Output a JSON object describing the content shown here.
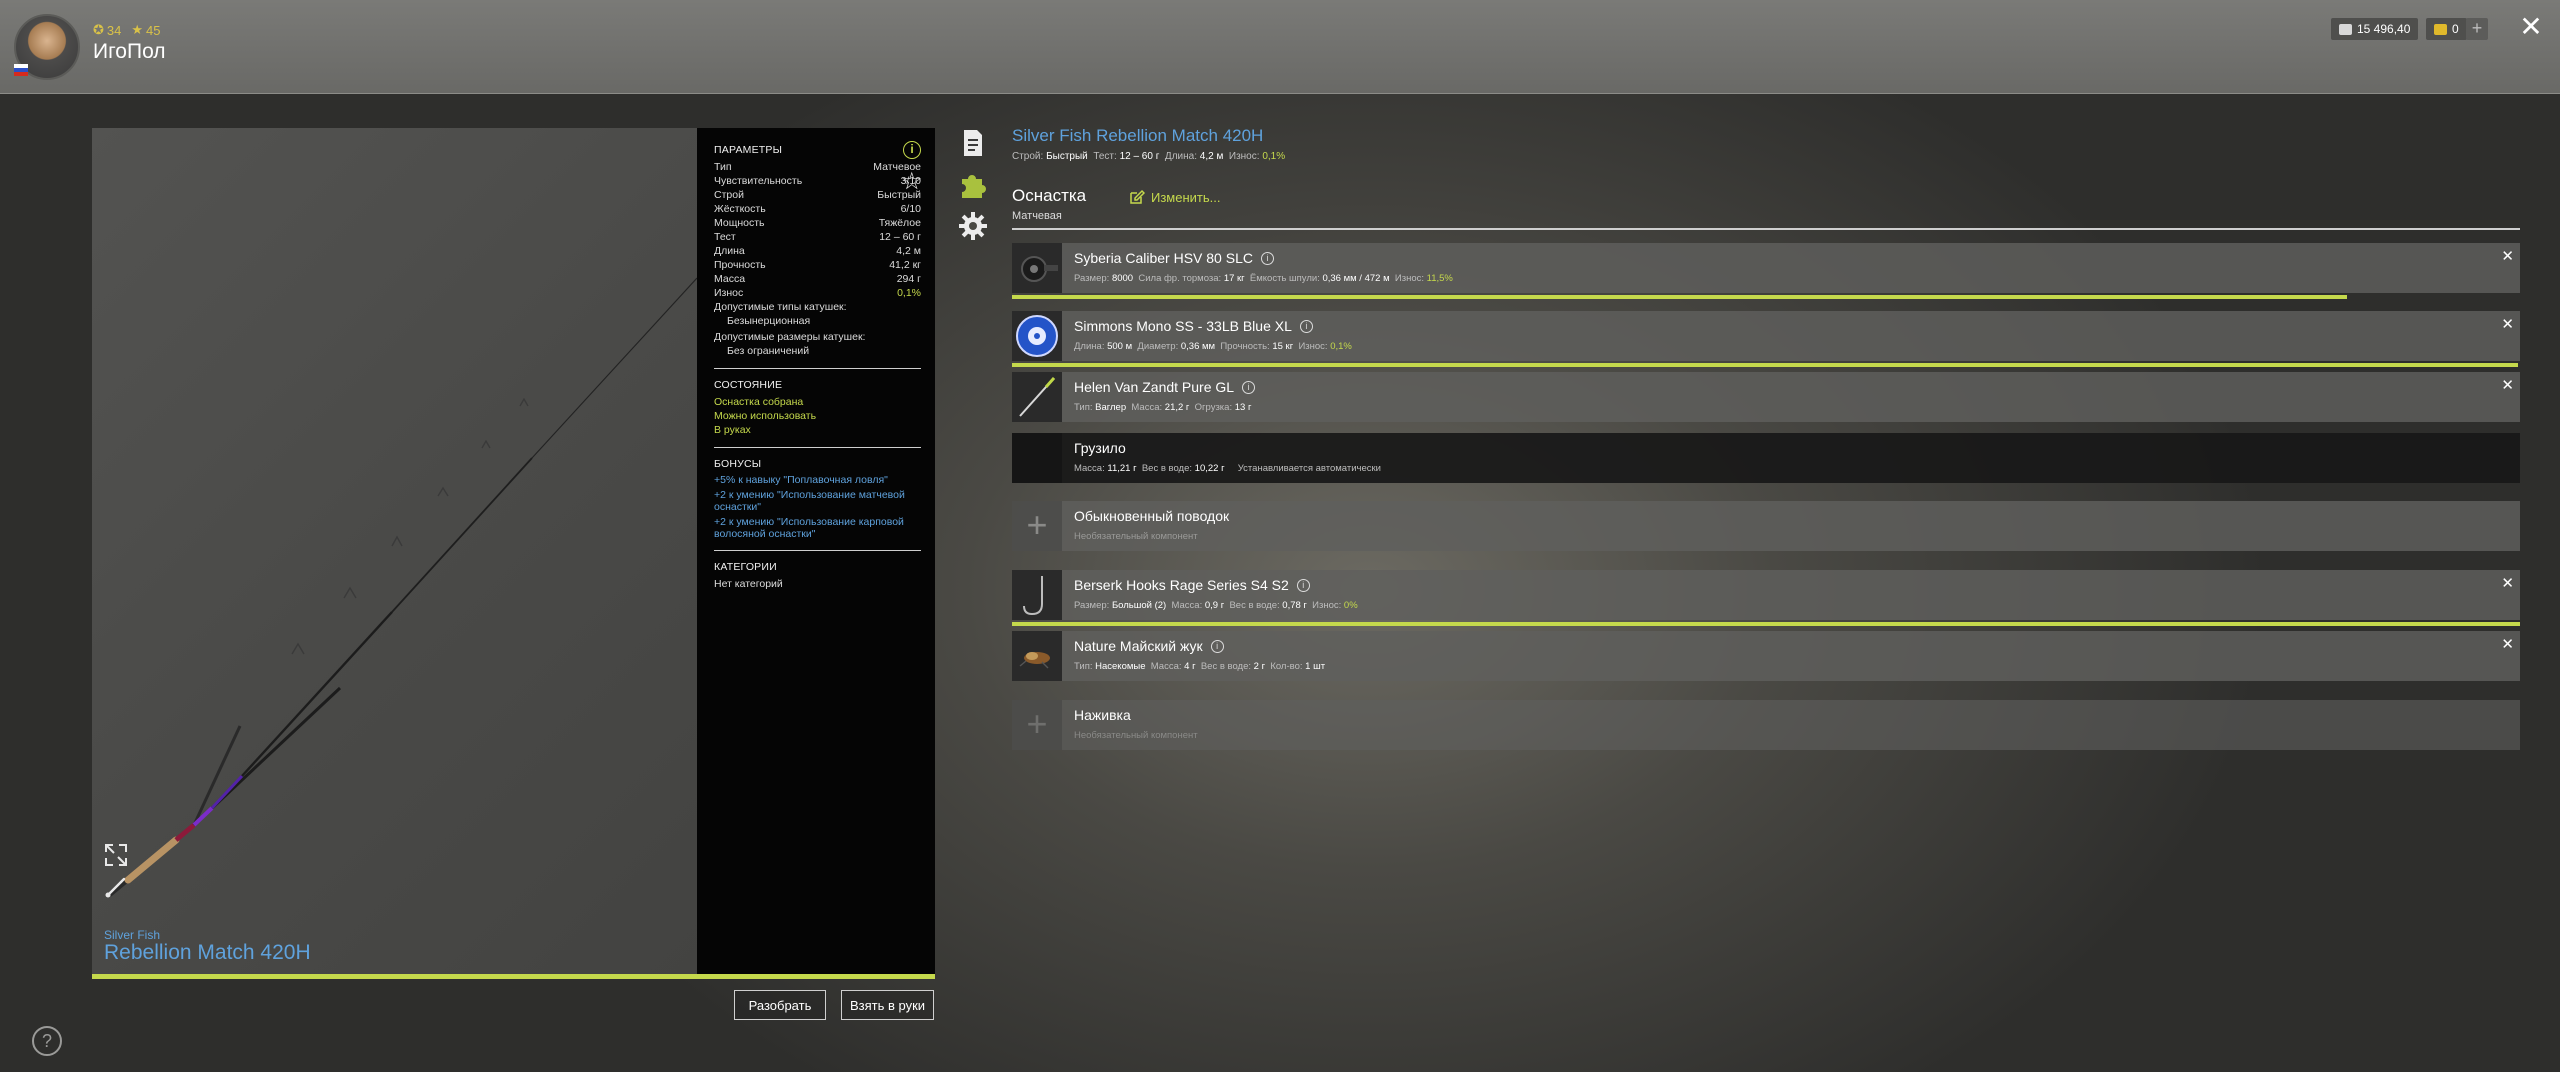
{
  "player": {
    "name": "ИгоПол",
    "level": "34",
    "rank": "45"
  },
  "wallet": {
    "silver": "15 496,40",
    "gold": "0"
  },
  "preview": {
    "brand": "Silver Fish",
    "model": "Rebellion Match 420H"
  },
  "params": {
    "heading": "ПАРАМЕТРЫ",
    "rows": [
      {
        "label": "Тип",
        "value": "Матчевое"
      },
      {
        "label": "Чувствительность",
        "value": "3/10"
      },
      {
        "label": "Строй",
        "value": "Быстрый"
      },
      {
        "label": "Жёсткость",
        "value": "6/10"
      },
      {
        "label": "Мощность",
        "value": "Тяжёлое"
      },
      {
        "label": "Тест",
        "value": "12 – 60 г"
      },
      {
        "label": "Длина",
        "value": "4,2 м"
      },
      {
        "label": "Прочность",
        "value": "41,2 кг"
      },
      {
        "label": "Масса",
        "value": "294 г"
      },
      {
        "label": "Износ",
        "value": "0,1%"
      }
    ],
    "reel_types_label": "Допустимые типы катушек:",
    "reel_types_value": "Безынерционная",
    "reel_sizes_label": "Допустимые размеры катушек:",
    "reel_sizes_value": "Без ограничений",
    "state_heading": "СОСТОЯНИЕ",
    "state_items": [
      "Оснастка собрана",
      "Можно использовать",
      "В руках"
    ],
    "bonus_heading": "БОНУСЫ",
    "bonus_items": [
      "+5% к навыку \"Поплавочная ловля\"",
      "+2 к умению \"Использование матчевой оснастки\"",
      "+2 к умению \"Использование карповой волосяной оснастки\""
    ],
    "categories_heading": "КАТЕГОРИИ",
    "categories_value": "Нет категорий"
  },
  "buttons": {
    "disassemble": "Разобрать",
    "take": "Взять в руки"
  },
  "rod": {
    "title": "Silver Fish Rebellion Match 420H",
    "stroy_label": "Строй:",
    "stroy": "Быстрый",
    "test_label": "Тест:",
    "test": "12 – 60 г",
    "length_label": "Длина:",
    "length": "4,2 м",
    "wear_label": "Износ:",
    "wear": "0,1%"
  },
  "rig": {
    "heading": "Оснастка",
    "type": "Матчевая",
    "edit_label": "Изменить..."
  },
  "slots": [
    {
      "name": "Syberia Caliber HSV 80 SLC",
      "details": [
        {
          "label": "Размер:",
          "value": "8000"
        },
        {
          "label": "Сила фр. тормоза:",
          "value": "17 кг"
        },
        {
          "label": "Ёмкость шпули:",
          "value": "0,36 мм / 472 м"
        },
        {
          "label": "Износ:",
          "value": "11,5%"
        }
      ],
      "wear_fraction": 0.885
    },
    {
      "name": "Simmons Mono SS - 33LB Blue XL",
      "details": [
        {
          "label": "Длина:",
          "value": "500 м"
        },
        {
          "label": "Диаметр:",
          "value": "0,36 мм"
        },
        {
          "label": "Прочность:",
          "value": "15 кг"
        },
        {
          "label": "Износ:",
          "value": "0,1%"
        }
      ],
      "wear_fraction": 0.999
    },
    {
      "name": "Helen Van Zandt Pure GL",
      "details": [
        {
          "label": "Тип:",
          "value": "Ваглер"
        },
        {
          "label": "Масса:",
          "value": "21,2 г"
        },
        {
          "label": "Огрузка:",
          "value": "13 г"
        }
      ]
    },
    {
      "name": "Грузило",
      "details": [
        {
          "label": "Масса:",
          "value": "11,21 г"
        },
        {
          "label": "Вес в воде:",
          "value": "10,22 г"
        }
      ],
      "note": "Устанавливается автоматически"
    },
    {
      "name": "Обыкновенный поводок",
      "note": "Необязательный компонент"
    },
    {
      "name": "Berserk Hooks Rage Series S4 S2",
      "details": [
        {
          "label": "Размер:",
          "value": "Большой (2)"
        },
        {
          "label": "Масса:",
          "value": "0,9 г"
        },
        {
          "label": "Вес в воде:",
          "value": "0,78 г"
        },
        {
          "label": "Износ:",
          "value": "0%"
        }
      ],
      "wear_fraction": 1.0
    },
    {
      "name": "Nature Майский жук",
      "details": [
        {
          "label": "Тип:",
          "value": "Насекомые"
        },
        {
          "label": "Масса:",
          "value": "4 г"
        },
        {
          "label": "Вес в воде:",
          "value": "2 г"
        },
        {
          "label": "Кол-во:",
          "value": "1 шт"
        }
      ]
    },
    {
      "name": "Наживка",
      "note": "Необязательный компонент"
    }
  ],
  "colors": {
    "accent": "#c5d94c",
    "link": "#5fa2dd"
  }
}
